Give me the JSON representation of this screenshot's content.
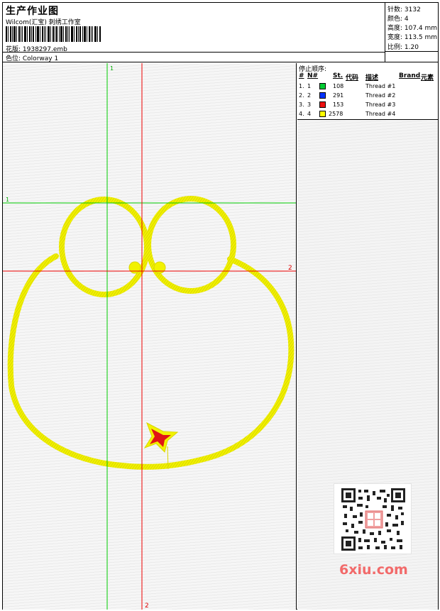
{
  "header": {
    "title": "生产作业图",
    "software": "Wilcom(汇宝) 刺绣工作室",
    "design": "花版:  1938297.emb",
    "colorway": "色位:  Colorway 1"
  },
  "stats": {
    "stitches": "针数:  3132",
    "colors": "颜色:  4",
    "height": "高度:  107.4 mm",
    "width": "宽度:  113.5 mm",
    "scale": "比例:  1.20"
  },
  "stop_sequence": {
    "title": "停止顺序:",
    "columns": {
      "num": "#",
      "n": "N#",
      "st": "St.",
      "code": "代码",
      "desc": "描述",
      "brand": "Brand",
      "element": "元素"
    },
    "rows": [
      {
        "num": "1.",
        "n": "1",
        "color": "#00cc33",
        "st": "108",
        "desc": "Thread #1"
      },
      {
        "num": "2.",
        "n": "2",
        "color": "#0033ff",
        "st": "291",
        "desc": "Thread #2"
      },
      {
        "num": "3.",
        "n": "3",
        "color": "#ee1111",
        "st": "153",
        "desc": "Thread #3"
      },
      {
        "num": "4.",
        "n": "4",
        "color": "#ffff00",
        "st": "2578",
        "desc": "Thread #4"
      }
    ]
  },
  "guides": {
    "green_top": "1",
    "green_left": "1",
    "red_right": "2",
    "red_bottom": "2"
  },
  "colors": {
    "thread_yellow": "#f2f200",
    "thread_red": "#e01515",
    "guide_green": "#00cc00",
    "guide_red": "#ee0000"
  },
  "watermark": "6xiu.com"
}
